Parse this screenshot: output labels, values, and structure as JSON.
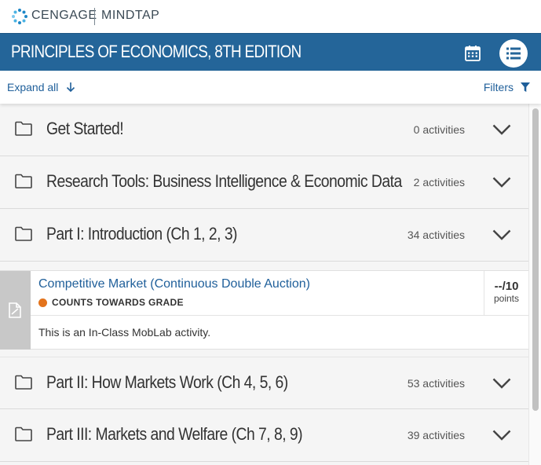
{
  "brand": {
    "name": "CENGAGE",
    "product": "MINDTAP",
    "logo_icon": "cengage-dots-icon"
  },
  "header": {
    "title": "PRINCIPLES OF ECONOMICS, 8TH EDITION",
    "calendar_icon": "calendar-icon",
    "list_icon": "list-view-icon"
  },
  "toolbar": {
    "expand_label": "Expand all",
    "filters_label": "Filters"
  },
  "folders": [
    {
      "title": "Get Started!",
      "count": "0 activities"
    },
    {
      "title": "Research Tools: Business Intelligence & Economic Data",
      "count": "2 activities"
    },
    {
      "title": "Part I: Introduction (Ch 1, 2, 3)",
      "count": "34 activities"
    },
    {
      "title": "Part II: How Markets Work (Ch 4, 5, 6)",
      "count": "53 activities"
    },
    {
      "title": "Part III: Markets and Welfare (Ch 7, 8, 9)",
      "count": "39 activities"
    }
  ],
  "activity": {
    "title": "Competitive Market (Continuous Double Auction)",
    "grade_label": "COUNTS TOWARDS GRADE",
    "score": "--/10",
    "score_unit": "points",
    "description": "This is an In-Class MobLab activity."
  },
  "colors": {
    "brand_blue": "#246599",
    "link_blue": "#1f5f9a",
    "grade_dot": "#e3731c"
  }
}
